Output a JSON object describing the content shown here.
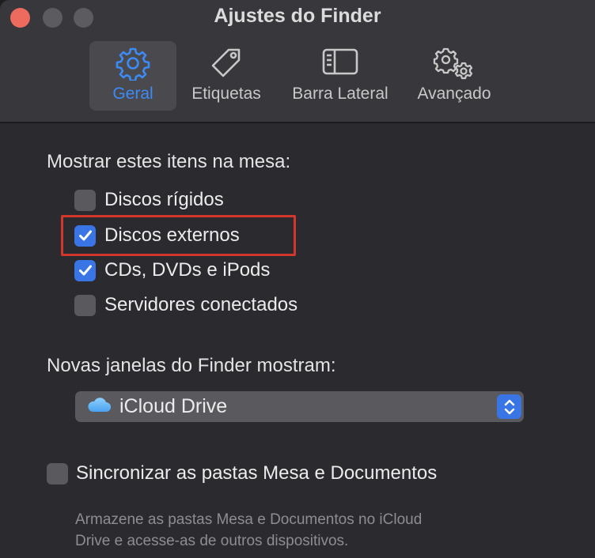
{
  "window": {
    "title": "Ajustes do Finder"
  },
  "tabs": [
    {
      "label": "Geral",
      "icon": "gear-icon",
      "active": true
    },
    {
      "label": "Etiquetas",
      "icon": "tag-icon",
      "active": false
    },
    {
      "label": "Barra Lateral",
      "icon": "sidebar-icon",
      "active": false
    },
    {
      "label": "Avançado",
      "icon": "gears-icon",
      "active": false
    }
  ],
  "desktop_section": {
    "heading": "Mostrar estes itens na mesa:",
    "items": [
      {
        "label": "Discos rígidos",
        "checked": false
      },
      {
        "label": "Discos externos",
        "checked": true
      },
      {
        "label": "CDs, DVDs e iPods",
        "checked": true
      },
      {
        "label": "Servidores conectados",
        "checked": false
      }
    ]
  },
  "new_windows": {
    "heading": "Novas janelas do Finder mostram:",
    "selected": "iCloud Drive",
    "icon": "icloud-icon"
  },
  "sync": {
    "label": "Sincronizar as pastas Mesa e Documentos",
    "checked": false,
    "hint_line1": "Armazene as pastas Mesa e Documentos no iCloud",
    "hint_line2": "Drive e acesse-as de outros dispositivos."
  },
  "colors": {
    "accent": "#3a75e6",
    "highlight_box": "#d2372d",
    "close_button": "#ec6a5e"
  }
}
